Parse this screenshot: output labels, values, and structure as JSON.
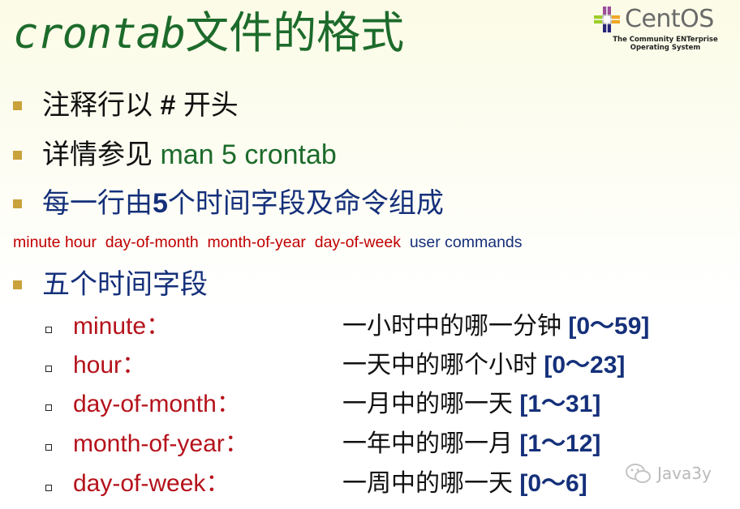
{
  "title": {
    "latin": "crontab",
    "cn": "文件的格式"
  },
  "logo": {
    "word": "CentOS",
    "tagline_1": "The Community ENTerprise",
    "tagline_2": "Operating System"
  },
  "bullets": [
    {
      "text_a": "注释行以 ",
      "text_b": "# ",
      "text_c": "开头"
    },
    {
      "text_a": "详情参见 ",
      "text_b": "man 5 crontab"
    },
    {
      "text_a": "每一行由",
      "text_b": "5",
      "text_c": "个时间字段及命令组成"
    },
    {
      "text_a": "五个时间字段"
    }
  ],
  "format_line": {
    "red_part": "minute hour  day-of-month  month-of-year  day-of-week",
    "navy_part": "user commands"
  },
  "fields": [
    {
      "name": "minute：",
      "desc": "一小时中的哪一分钟",
      "range": "[0～59]"
    },
    {
      "name": "hour：",
      "desc": "一天中的哪个小时",
      "range": "[0～23]"
    },
    {
      "name": "day-of-month：",
      "desc": "一月中的哪一天",
      "range": "[1～31]"
    },
    {
      "name": "month-of-year：",
      "desc": "一年中的哪一月",
      "range": "[1～12]"
    },
    {
      "name": "day-of-week：",
      "desc": "一周中的哪一天",
      "range": "[0～6]"
    }
  ],
  "watermark": {
    "text": "Java3y"
  },
  "colors": {
    "title_green": "#1d6b2b",
    "bullet_gold": "#c9a23b",
    "field_red": "#b5121b",
    "range_navy": "#15307a"
  }
}
